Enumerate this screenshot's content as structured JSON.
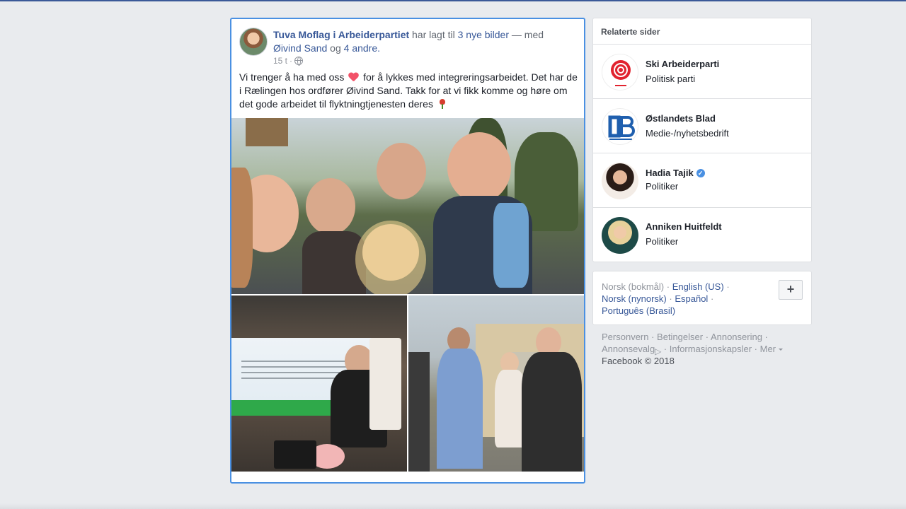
{
  "post": {
    "author": "Tuva Moflag i Arbeiderpartiet",
    "action": "har lagt til",
    "photos_link": "3 nye bilder",
    "with": "— med",
    "tagged_person": "Øivind Sand",
    "and": "og",
    "others_link": "4 andre",
    "period": ".",
    "time": "15 t",
    "dot": "·",
    "privacy_icon": "globe-icon",
    "text_part1": "Vi trenger å ha med oss",
    "text_part2": "for å lykkes med integreringsarbeidet. Det har de i Rælingen hos ordfører Øivind Sand. Takk for at vi fikk komme og høre om det gode arbeidet til flyktningtjenesten deres",
    "emoji_heart": "heart-emoji",
    "emoji_rose": "rose-emoji"
  },
  "related": {
    "title": "Relaterte sider",
    "items": [
      {
        "name": "Ski Arbeiderparti",
        "category": "Politisk parti",
        "verified": false
      },
      {
        "name": "Østlandets Blad",
        "category": "Medie-/nyhetsbedrift",
        "verified": false
      },
      {
        "name": "Hadia Tajik",
        "category": "Politiker",
        "verified": true
      },
      {
        "name": "Anniken Huitfeldt",
        "category": "Politiker",
        "verified": false
      }
    ]
  },
  "languages": {
    "current": "Norsk (bokmål)",
    "options": [
      "English (US)",
      "Norsk (nynorsk)",
      "Español",
      "Português (Brasil)"
    ],
    "sep": "·",
    "add": "+"
  },
  "footer": {
    "links": [
      "Personvern",
      "Betingelser",
      "Annonsering",
      "Annonsevalg",
      "Informasjonskapsler",
      "Mer"
    ],
    "copyright": "Facebook © 2018"
  },
  "colors": {
    "link": "#385898",
    "accent_border": "#4a90e2",
    "background": "#e9ebee"
  }
}
